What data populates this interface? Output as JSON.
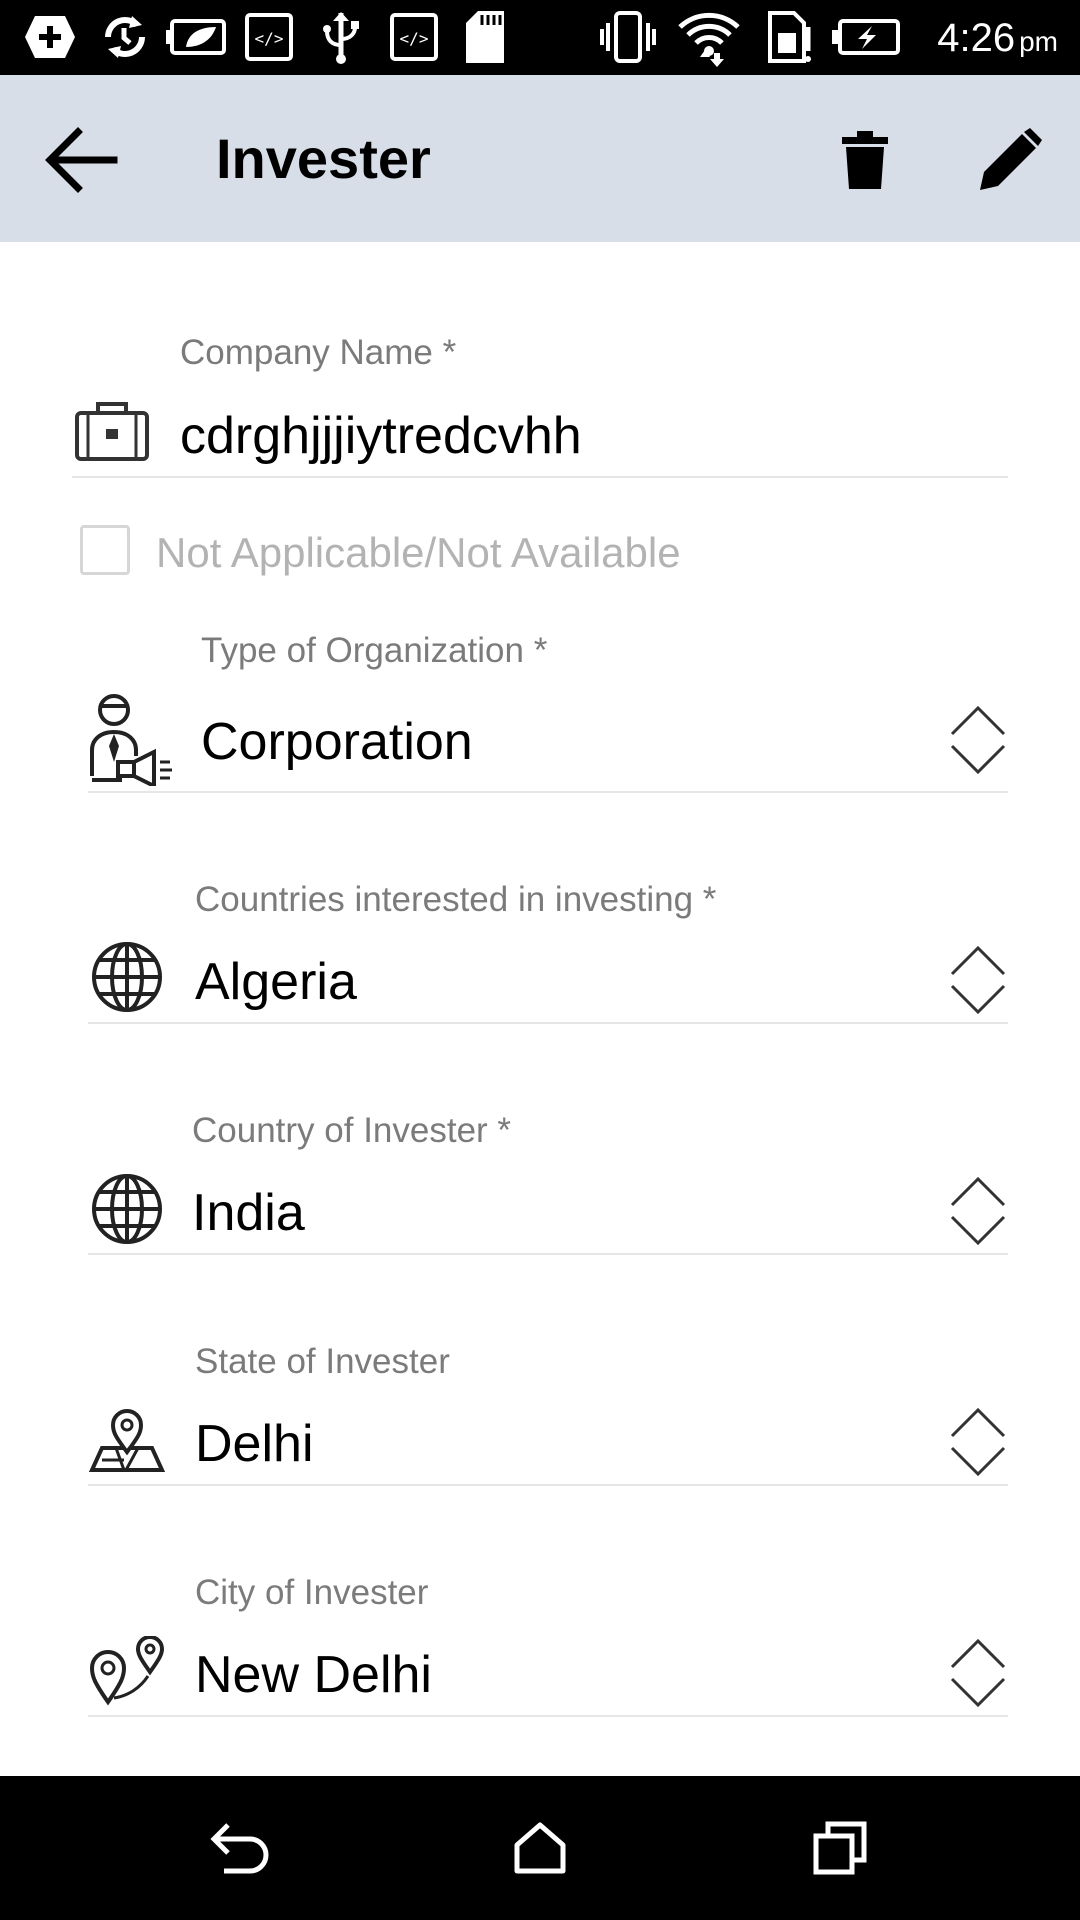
{
  "status_bar": {
    "time": "4:26",
    "ampm": "pm",
    "icons": [
      "add-box-icon",
      "sync-icon",
      "battery-saver-icon",
      "code-icon",
      "usb-icon",
      "code-icon",
      "sd-card-icon",
      "vibrate-icon",
      "wifi-icon",
      "sim-alert-icon",
      "battery-charging-icon"
    ]
  },
  "app_bar": {
    "title": "Invester",
    "back_icon": "arrow-back-icon",
    "delete_icon": "trash-icon",
    "edit_icon": "pencil-icon",
    "background": "#d7dee7"
  },
  "form": {
    "company_name": {
      "label": "Company Name *",
      "value": "cdrghjjjiytredcvhh",
      "icon": "briefcase-icon"
    },
    "not_applicable": {
      "label": "Not Applicable/Not Available",
      "checked": false
    },
    "org_type": {
      "label": "Type of Organization *",
      "value": "Corporation",
      "icon": "businessman-icon"
    },
    "countries_interested": {
      "label": "Countries interested in investing *",
      "value": "Algeria",
      "icon": "globe-icon"
    },
    "country": {
      "label": "Country of Invester *",
      "value": "India",
      "icon": "globe-icon"
    },
    "state": {
      "label": "State of Invester",
      "value": "Delhi",
      "icon": "map-pin-icon"
    },
    "city": {
      "label": "City of Invester",
      "value": "New Delhi",
      "icon": "location-pins-icon"
    }
  },
  "nav_bar": {
    "back_icon": "nav-back-icon",
    "home_icon": "nav-home-icon",
    "recents_icon": "nav-recents-icon"
  }
}
